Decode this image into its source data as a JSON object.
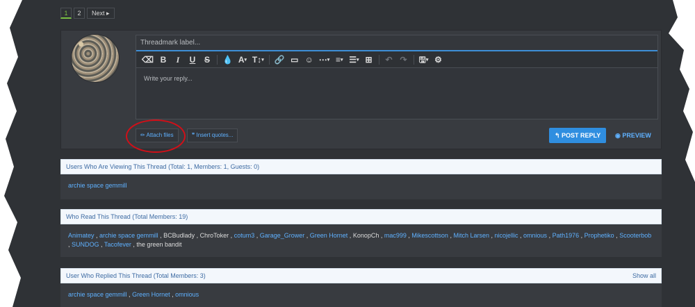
{
  "pagination": {
    "pages": [
      "1",
      "2"
    ],
    "active": "1",
    "next_label": "Next ▸"
  },
  "editor": {
    "threadmark_placeholder": "Threadmark label...",
    "reply_placeholder": "Write your reply...",
    "toolbar_icons": [
      "eraser-icon",
      "bold-icon",
      "italic-icon",
      "underline-icon",
      "strike-icon",
      "color-icon",
      "font-size-icon",
      "text-size-icon",
      "link-icon",
      "image-icon",
      "emoji-icon",
      "more-icon",
      "align-icon",
      "list-icon",
      "table-icon",
      "undo-icon",
      "redo-icon",
      "save-draft-icon",
      "settings-icon"
    ]
  },
  "actions": {
    "attach": "✏ Attach files",
    "quotes": "❞ Insert quotes...",
    "post": "↰ POST REPLY",
    "preview": "◉ PREVIEW"
  },
  "viewing": {
    "title": "Users Who Are Viewing This Thread (Total: 1, Members: 1, Guests: 0)",
    "users": [
      "archie space gemmill"
    ]
  },
  "read": {
    "title": "Who Read This Thread (Total Members: 19)",
    "users": [
      {
        "name": "Animatey",
        "link": true
      },
      {
        "name": "archie space gemmill",
        "link": true
      },
      {
        "name": "BCBudlady",
        "link": false
      },
      {
        "name": "ChroToker",
        "link": false
      },
      {
        "name": "cotum3",
        "link": true
      },
      {
        "name": "Garage_Grower",
        "link": true
      },
      {
        "name": "Green Hornet",
        "link": true
      },
      {
        "name": "KonopCh",
        "link": false
      },
      {
        "name": "mac999",
        "link": true
      },
      {
        "name": "Mikescottson",
        "link": true
      },
      {
        "name": "Mitch Larsen",
        "link": true
      },
      {
        "name": "nicojellic",
        "link": true
      },
      {
        "name": "omnious",
        "link": true
      },
      {
        "name": "Path1976",
        "link": true
      },
      {
        "name": "Prophetiko",
        "link": true
      },
      {
        "name": "Scooterbob",
        "link": true
      },
      {
        "name": "SUNDOG",
        "link": true
      },
      {
        "name": "Tacofever",
        "link": true
      },
      {
        "name": "the green bandit",
        "link": false
      }
    ]
  },
  "replied": {
    "title": "User Who Replied This Thread (Total Members: 3)",
    "show_all": "Show all",
    "users": [
      "archie space gemmill",
      "Green Hornet",
      "omnious"
    ]
  },
  "colors": {
    "accent": "#5fb1ff",
    "panel": "#383b40",
    "highlight": "#d20f18"
  }
}
